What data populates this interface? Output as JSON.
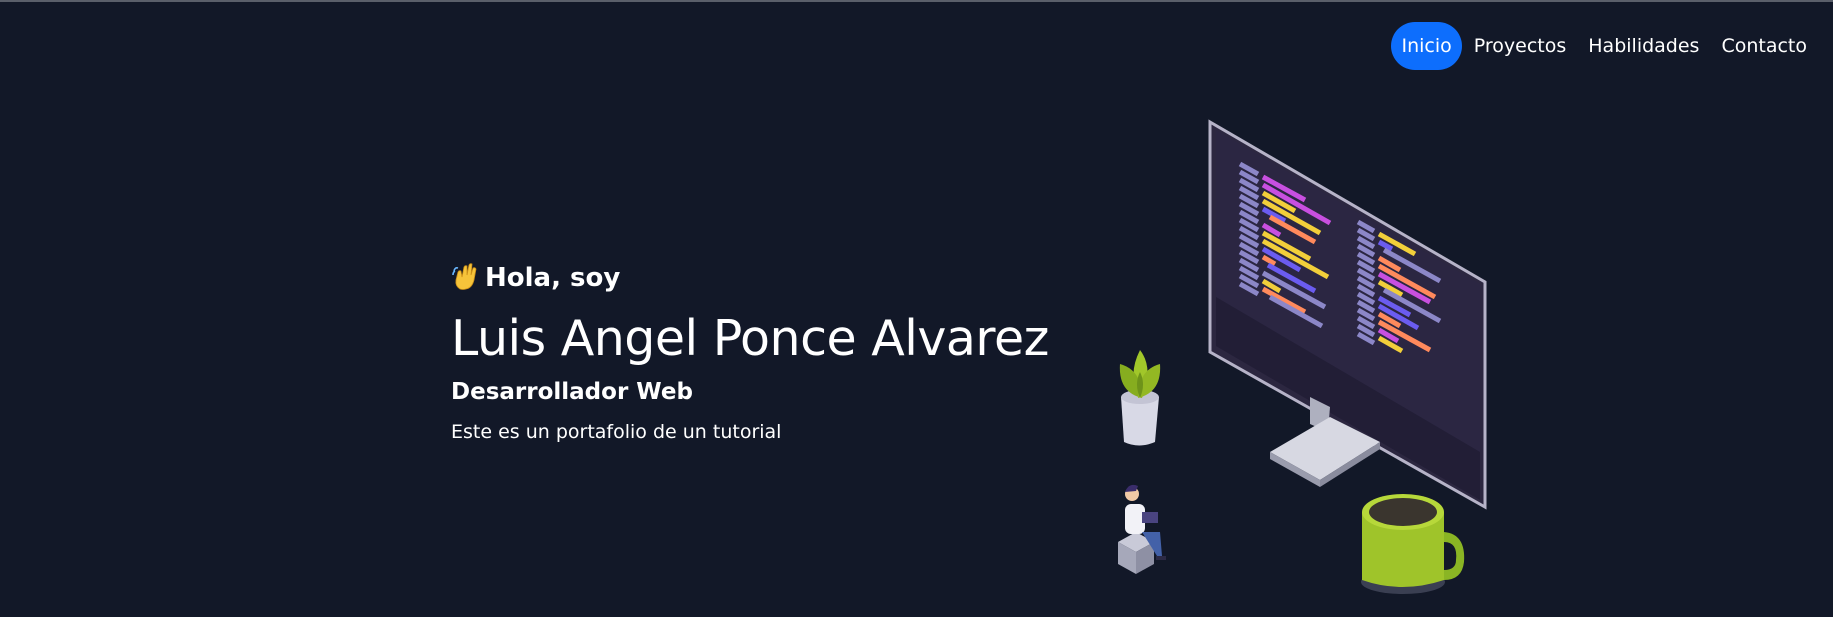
{
  "nav": {
    "items": [
      {
        "label": "Inicio",
        "active": true
      },
      {
        "label": "Proyectos",
        "active": false
      },
      {
        "label": "Habilidades",
        "active": false
      },
      {
        "label": "Contacto",
        "active": false
      }
    ]
  },
  "hero": {
    "greeting": "Hola, soy",
    "name": "Luis Angel Ponce Alvarez",
    "role": "Desarrollador Web",
    "description": "Este es un portafolio de un tutorial"
  },
  "colors": {
    "background": "#121828",
    "accent": "#0d6efd",
    "text": "#ffffff"
  },
  "icons": {
    "greeting_icon": "waving-hand-icon",
    "illustration": "developer-workspace-illustration"
  }
}
